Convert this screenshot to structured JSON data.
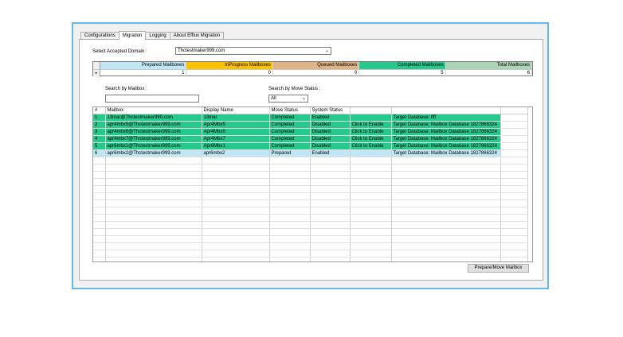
{
  "tabs": [
    "Configurations",
    "Migration",
    "Logging",
    "About Efflux Migration"
  ],
  "domain_label": "Select Accepted Domain :",
  "domain_value": "Thctestmaker999.com",
  "summary": {
    "headers": [
      "Prepared Mailboxes",
      "InProgress Mailboxes",
      "Queued Mailboxes",
      "Completed Mailboxes",
      "Total Mailboxes"
    ],
    "colors": [
      "#bfe7f5",
      "#fbc200",
      "#e0b387",
      "#27c88b",
      "#aed4b6"
    ],
    "values": [
      "1",
      "0",
      "0",
      "5",
      "6"
    ],
    "row_marker": "▸"
  },
  "search_mailbox_label": "Search by Mailbox :",
  "search_status_label": "Search by Move Status :",
  "status_value": "All",
  "grid": {
    "columns": [
      "#",
      "Mailbox",
      "Display Name",
      "Move Status",
      "System Status",
      "",
      ""
    ],
    "rows": [
      [
        "1",
        "13mar@Thctestmaker999.com",
        "13mar",
        "Completed",
        "Enabled",
        "",
        "Target Database: ffff"
      ],
      [
        "2",
        "apr4mbx5@Thctestmaker999.com",
        "Apr4Mbx5",
        "Completed",
        "Disabled",
        "Click to Enable",
        "Target Database: Mailbox Database 1827866324"
      ],
      [
        "3",
        "apr4mbx6@Thctestmaker999.com",
        "Apr4Mbx6",
        "Completed",
        "Disabled",
        "Click to Enable",
        "Target Database: Mailbox Database 1827866324"
      ],
      [
        "4",
        "apr4mbx7@Thctestmaker999.com",
        "Apr4Mbx7",
        "Completed",
        "Disabled",
        "Click to Enable",
        "Target Database: Mailbox Database 1827866324"
      ],
      [
        "5",
        "apr6mbx1@Thctestmaker999.com",
        "Apr6Mbx1",
        "Completed",
        "Disabled",
        "Click to Enable",
        "Target Database: Mailbox Database 1827866324"
      ],
      [
        "6",
        "apr6mbx2@Thctestmaker999.com",
        "apr6mbx2",
        "Prepared",
        "Enabled",
        "",
        "Target Database: Mailbox Database 1827866324"
      ]
    ],
    "row_colors": [
      "#27c88b",
      "#27c88b",
      "#27c88b",
      "#27c88b",
      "#27c88b",
      "#bfe7f5"
    ]
  },
  "action_button": "Prepare/Move Mailbox"
}
